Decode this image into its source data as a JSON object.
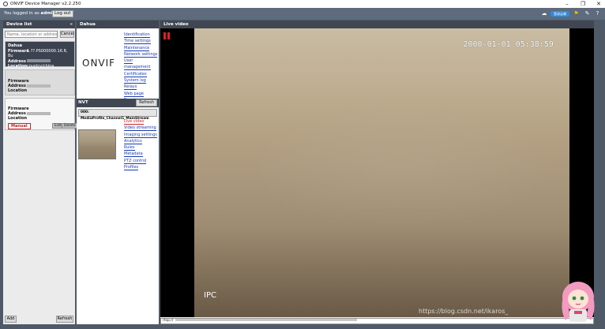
{
  "window": {
    "title": "ONVIF Device Manager v2.2.250"
  },
  "topbar": {
    "logged_prefix": "You logged in as",
    "username": "admin",
    "logout_label": "Log out",
    "cloud_label": "登录云端"
  },
  "device_list": {
    "title": "Device list",
    "collapse_icon": "«",
    "search_placeholder": "Name, location or address",
    "cancel_label": "Cancel",
    "devices": [
      {
        "name": "Dahua",
        "firmware_label": "Firmware",
        "firmware": "1.??.PS000000.16.R, Bu",
        "address_label": "Address",
        "location_label": "Location",
        "location": "country/china"
      },
      {
        "firmware_label": "Firmware",
        "address_label": "Address",
        "location_label": "Location"
      },
      {
        "firmware_label": "Firmware",
        "address_label": "Address",
        "location_label": "Location",
        "tag": "Manual",
        "edit_label": "Edit",
        "delete_label": "Delete"
      }
    ],
    "add_label": "Add",
    "refresh_label": "Refresh"
  },
  "device_panel": {
    "title": "Dahua",
    "logo_text": "ONVIF",
    "links": [
      "Identification",
      "Time settings",
      "Maintenance",
      "Network settings",
      "User management",
      "Certificates",
      "System log",
      "Relays",
      "Web page",
      "Events"
    ],
    "nvt_title": "NVT",
    "nvt_refresh_label": "Refresh",
    "profile_name": "000: MediaProfile_Channel1_MainStream",
    "profile_links": [
      "Live video",
      "Video streaming",
      "Imaging settings",
      "Analytics",
      "Rules",
      "Metadata",
      "PTZ control",
      "Profiles"
    ],
    "active_profile_link": "Live video"
  },
  "live_video": {
    "title": "Live video",
    "osd_timestamp": "2000-01-01 05:38:59",
    "osd_label": "IPC",
    "url": "rtsp://"
  },
  "watermark": "https://blog.csdn.net/ikaros_"
}
